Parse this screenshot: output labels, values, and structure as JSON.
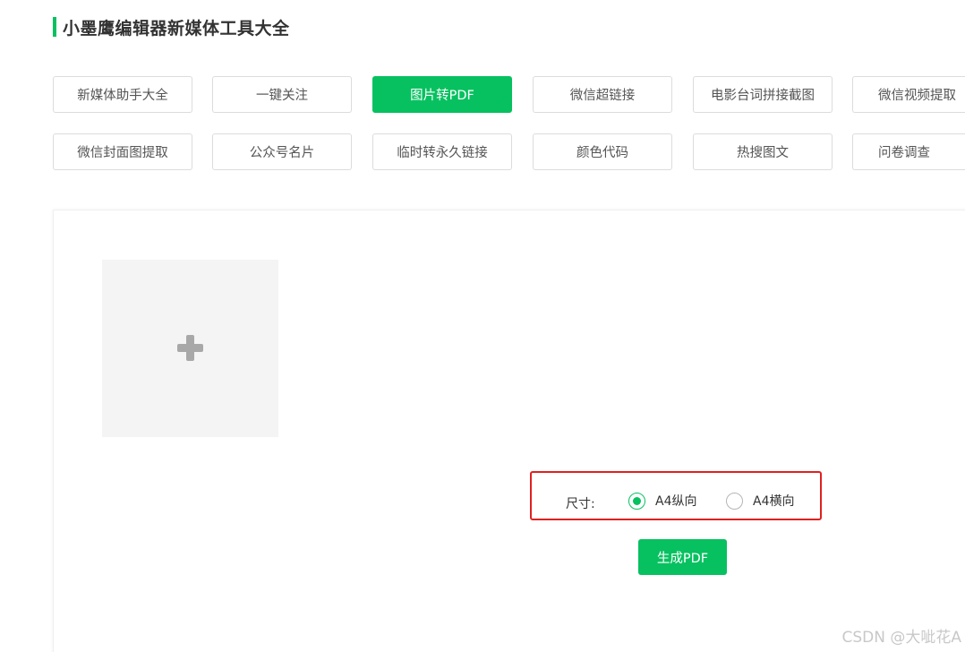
{
  "header": {
    "title": "小墨鹰编辑器新媒体工具大全"
  },
  "tools": {
    "row1": [
      {
        "label": "新媒体助手大全"
      },
      {
        "label": "一键关注"
      },
      {
        "label": "图片转PDF",
        "active": true
      },
      {
        "label": "微信超链接"
      },
      {
        "label": "电影台词拼接截图"
      },
      {
        "label": "微信视频提取"
      }
    ],
    "row2": [
      {
        "label": "微信封面图提取"
      },
      {
        "label": "公众号名片"
      },
      {
        "label": "临时转永久链接"
      },
      {
        "label": "颜色代码"
      },
      {
        "label": "热搜图文"
      },
      {
        "label": "问卷调查"
      }
    ]
  },
  "upload": {
    "icon": "plus-icon"
  },
  "size": {
    "label": "尺寸:",
    "options": [
      {
        "label": "A4纵向",
        "checked": true
      },
      {
        "label": "A4横向",
        "checked": false
      }
    ]
  },
  "generate_label": "生成PDF",
  "watermark": "CSDN @大呲花A",
  "colors": {
    "accent": "#07c160",
    "highlight_border": "#e02020"
  }
}
